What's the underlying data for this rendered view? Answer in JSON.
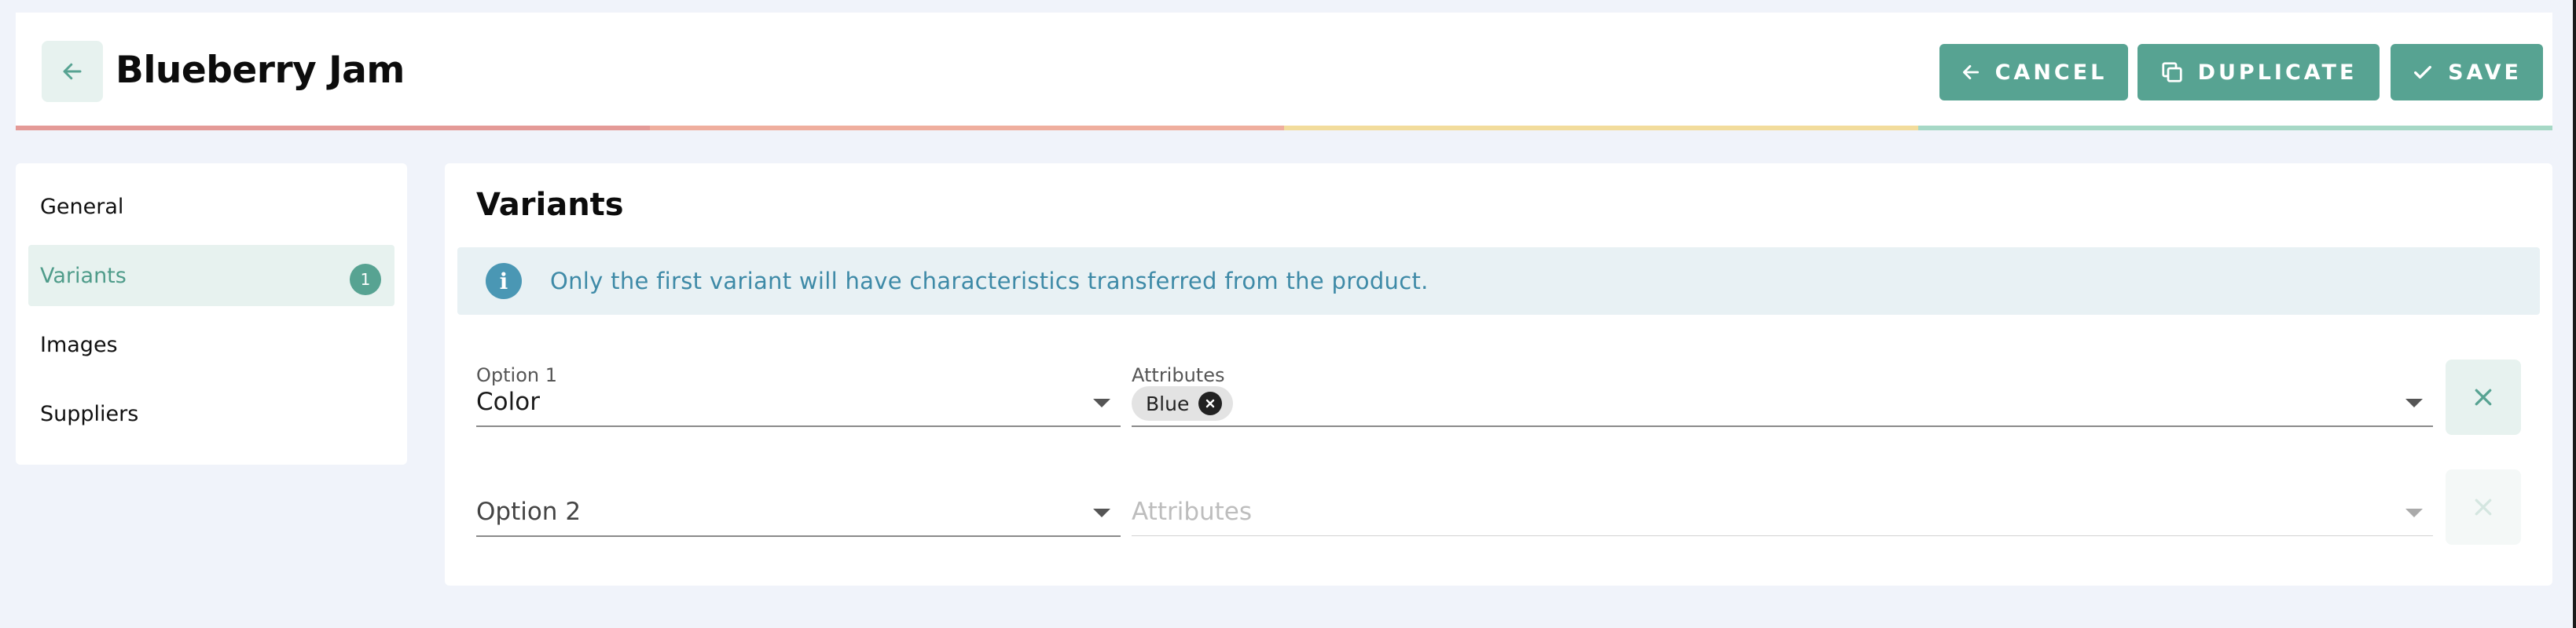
{
  "header": {
    "title": "Blueberry Jam",
    "buttons": {
      "cancel": "CANCEL",
      "duplicate": "DUPLICATE",
      "save": "SAVE"
    },
    "progress_colors": [
      "#e49a97",
      "#efae9e",
      "#f2dc9c",
      "#a6d8c6"
    ]
  },
  "sidebar": {
    "items": [
      {
        "label": "General"
      },
      {
        "label": "Variants",
        "badge": "1",
        "active": true
      },
      {
        "label": "Images"
      },
      {
        "label": "Suppliers"
      }
    ]
  },
  "main": {
    "section_title": "Variants",
    "info": {
      "icon": "info-icon",
      "text": "Only the first variant will have characteristics transferred from the product."
    },
    "variants": [
      {
        "option_label": "Option 1",
        "option_value": "Color",
        "attributes_label": "Attributes",
        "chips": [
          "Blue"
        ]
      },
      {
        "option_placeholder": "Option 2",
        "attributes_placeholder": "Attributes"
      }
    ]
  },
  "colors": {
    "accent": "#57a392",
    "accent_light": "#e7f2ef",
    "info_text": "#3e8aa7",
    "info_bg": "#e8f1f4",
    "page_bg": "#f0f3fa"
  }
}
